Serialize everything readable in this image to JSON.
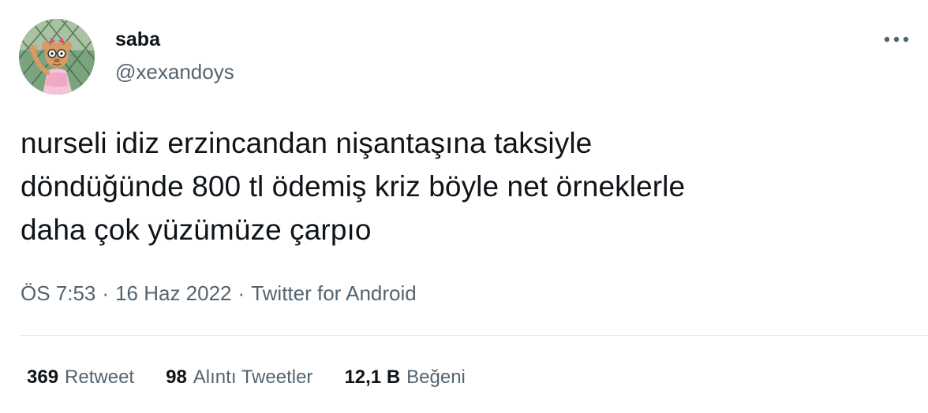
{
  "user": {
    "display_name": "saba",
    "handle": "@xexandoys"
  },
  "tweet": {
    "text": "nurseli idiz erzincandan nişantaşına taksiyle\ndöndüğünde 800 tl ödemiş kriz böyle net örneklerle\ndaha çok yüzümüze çarpıo"
  },
  "meta": {
    "time": "ÖS 7:53",
    "date": "16 Haz 2022",
    "separator": "·",
    "source": "Twitter for Android"
  },
  "stats": {
    "retweets": {
      "count": "369",
      "label": "Retweet"
    },
    "quotes": {
      "count": "98",
      "label": "Alıntı Tweetler"
    },
    "likes": {
      "count": "12,1 B",
      "label": "Beğeni"
    }
  },
  "icons": {
    "more": "more-horizontal-icon",
    "avatar": "avatar-cartoon"
  },
  "colors": {
    "text_primary": "#0f1419",
    "text_secondary": "#536471",
    "divider": "#e3e7ea"
  }
}
